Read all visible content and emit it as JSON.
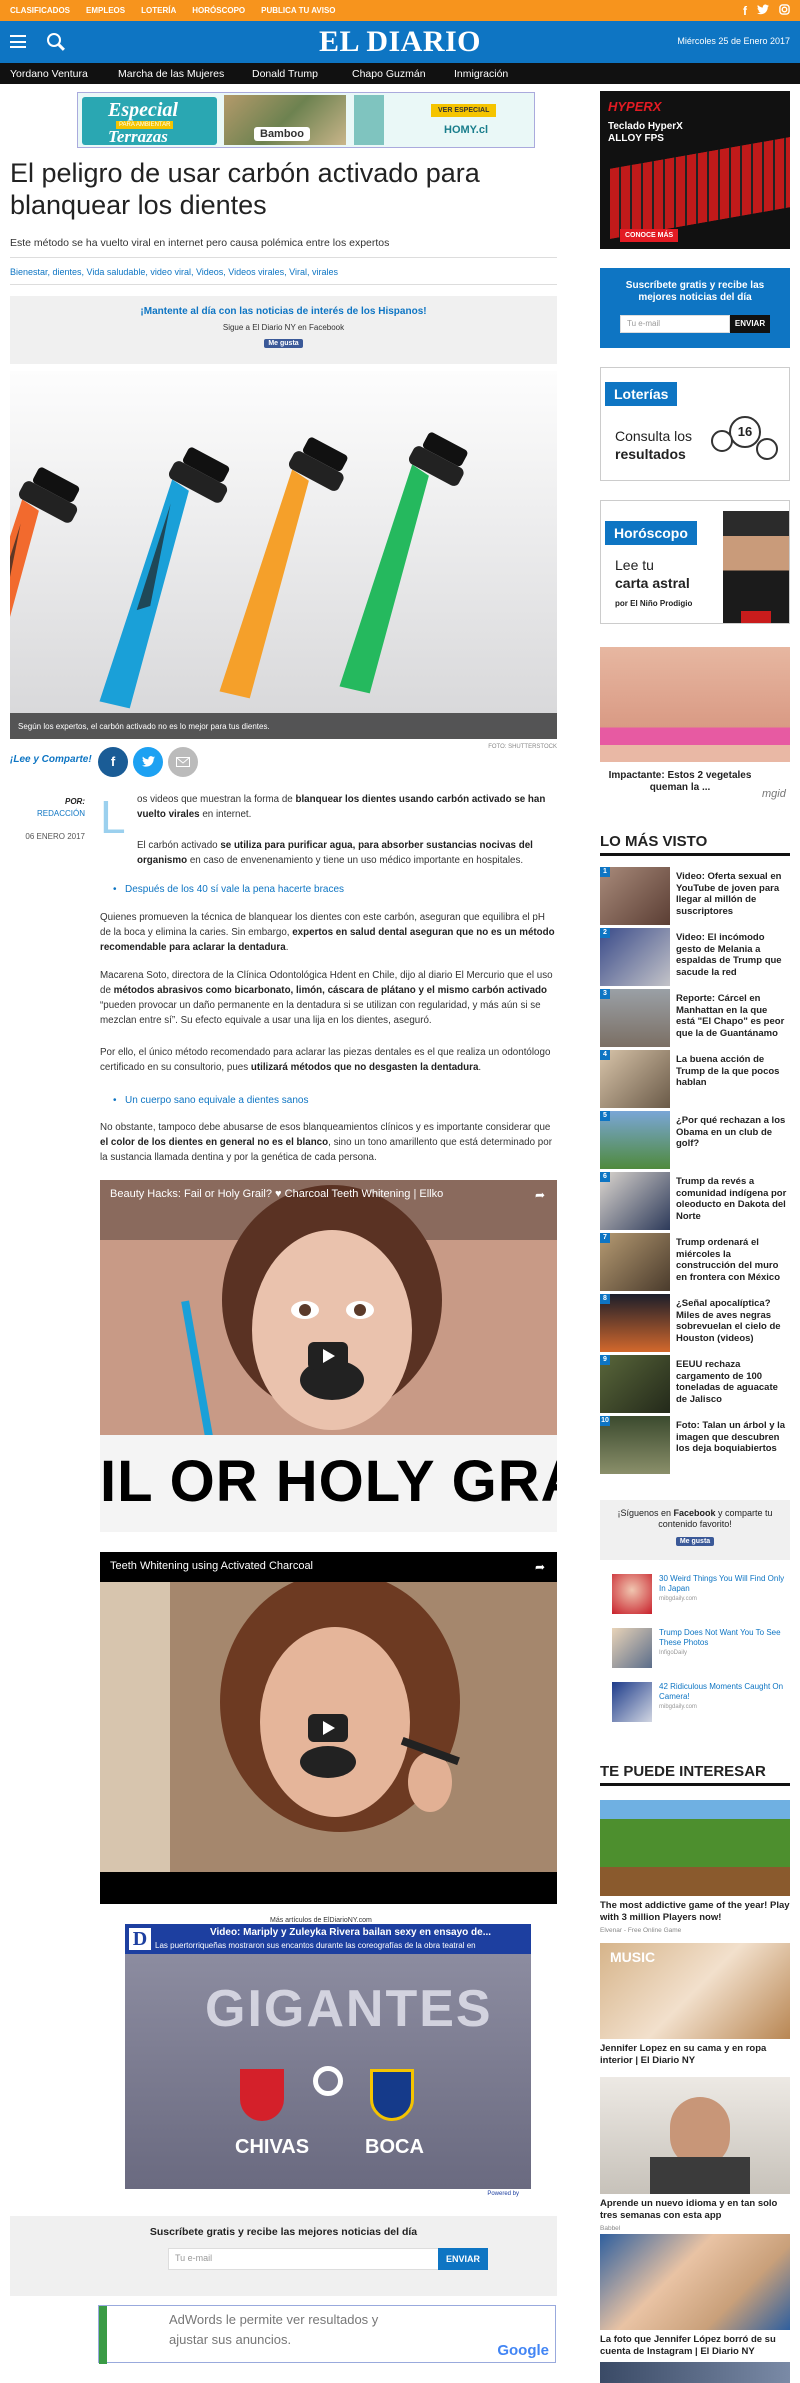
{
  "topbar": {
    "links": [
      "CLASIFICADOS",
      "EMPLEOS",
      "LOTERÍA",
      "HORÓSCOPO",
      "PUBLICA TU AVISO"
    ],
    "social": [
      "f",
      "t",
      "ig"
    ]
  },
  "header": {
    "logo": "EL DIARIO",
    "date": "Miércoles 25 de Enero 2017"
  },
  "nav": {
    "items": [
      "Yordano Ventura",
      "Marcha de las Mujeres",
      "Donald Trump",
      "Chapo Guzmán",
      "Inmigración"
    ]
  },
  "top_ad": {
    "headline": "Especial",
    "sub": "Terrazas",
    "badge": "PARA AMBIENTAR",
    "brand": "Bamboo",
    "cta": "VER ESPECIAL",
    "store": "HOMY.cl"
  },
  "side_ad": {
    "brand": "HYPERX",
    "line1": "Teclado HyperX",
    "line2": "ALLOY FPS",
    "cta": "CONOCE MÁS"
  },
  "article": {
    "title": "El peligro de usar carbón activado para blanquear los dientes",
    "subtitle": "Este método se ha vuelto viral en internet pero causa polémica entre los expertos",
    "tags": "Bienestar, dientes, Vida saludable, video viral, Videos, Videos virales, Viral, virales",
    "fb_promo": {
      "heading": "¡Mantente al día con las noticias de interés de los Hispanos!",
      "sub": "Sigue a El Diario NY en Facebook",
      "button": "Me gusta"
    },
    "hero_caption": "Según los expertos, el carbón activado no es lo mejor para tus dientes.",
    "photo_credit": "FOTO: SHUTTERSTOCK",
    "share_label": "¡Lee y Comparte!",
    "byline": {
      "por": "POR:",
      "author": "REDACCIÓN",
      "date": "06 ENERO 2017"
    },
    "dropcap": "L",
    "p1_a": "os videos que muestran la forma de ",
    "p1_b": "blanquear los dientes usando carbón activado se han vuelto virales",
    "p1_c": " en internet.",
    "p2_a": "El carbón activado ",
    "p2_b": "se utiliza para purificar agua, para absorber sustancias nocivas del organismo",
    "p2_c": " en caso de envenenamiento y tiene un uso médico importante en hospitales.",
    "link1": "Después de los 40 sí vale la pena hacerte braces",
    "p3_a": "Quienes promueven la técnica de blanquear los dientes con este carbón, aseguran que equilibra el pH de la boca y elimina la caries. Sin embargo, ",
    "p3_b": "expertos en salud dental aseguran que no es un método recomendable para aclarar la dentadura",
    "p3_c": ".",
    "p4_a": "Macarena Soto, directora de la Clínica Odontológica Hdent en Chile, dijo al diario El Mercurio que el uso de ",
    "p4_b": "métodos abrasivos como bicarbonato, limón, cáscara de plátano y el mismo carbón activado",
    "p4_c": " “pueden provocar un daño permanente en la dentadura si se utilizan con regularidad, y más aún si se mezclan entre sí”. Su efecto equivale a usar una lija en los dientes, aseguró.",
    "p5_a": "Por ello, el único método recomendado para aclarar las piezas dentales es el que realiza un odontólogo certificado en su consultorio, pues ",
    "p5_b": "utilizará métodos que no desgasten la dentadura",
    "p5_c": ".",
    "link2": "Un cuerpo sano equivale a dientes sanos",
    "p6_a": "No obstante, tampoco debe abusarse de esos blanqueamientos clínicos y es importante considerar que ",
    "p6_b": "el color de los dientes en general no es el blanco",
    "p6_c": ", sino un tono amarillento que está determinado por la sustancia llamada dentina y por la genética de cada persona.",
    "video1": {
      "title": "Beauty Hacks: Fail or Holy Grail? ♥ Charcoal Teeth Whitening | Ellko",
      "overlay": "IL OR HOLY GRAI"
    },
    "video2": {
      "title": "Teeth Whitening using Activated Charcoal"
    },
    "more_label": "Más artículos de ElDiarioNY.com",
    "more_video": {
      "title": "Video: Mariply y Zuleyka Rivera bailan sexy en ensayo de...",
      "desc": "Las puertorriqueñas mostraron sus encantos durante las coreografías de la obra teatral en",
      "big": "GIGANTES",
      "team1": "CHIVAS",
      "team2": "BOCA",
      "powered": "Powered by"
    },
    "subscribe": {
      "heading": "Suscríbete gratis y recibe las mejores noticias del día",
      "placeholder": "Tu e-mail",
      "button": "ENVIAR"
    },
    "google_ad": {
      "text1": "AdWords le permite ver resultados y",
      "text2": "ajustar sus anuncios.",
      "brand": "Google"
    }
  },
  "sidebar": {
    "subscribe": {
      "heading": "Suscríbete gratis y recibe las mejores noticias del día",
      "placeholder": "Tu e-mail",
      "button": "ENVIAR"
    },
    "loterias": {
      "label": "Loterías",
      "text1": "Consulta los",
      "text2": "resultados"
    },
    "horoscopo": {
      "label": "Horóscopo",
      "text1": "Lee tu",
      "text2": "carta astral",
      "text3": "por El Niño Prodigio"
    },
    "promo": {
      "text": "Impactante: Estos 2 vegetales queman la ...",
      "brand": "mgid"
    },
    "mas_visto": {
      "heading": "LO MÁS VISTO",
      "items": [
        {
          "num": "1",
          "title": "Video: Oferta sexual en YouTube de joven para llegar al millón de suscriptores"
        },
        {
          "num": "2",
          "title": "Video: El incómodo gesto de Melania a espaldas de Trump que sacude la red"
        },
        {
          "num": "3",
          "title": "Reporte: Cárcel en Manhattan en la que está \"El Chapo\" es peor que la de Guantánamo"
        },
        {
          "num": "4",
          "title": "La buena acción de Trump de la que pocos hablan"
        },
        {
          "num": "5",
          "title": "¿Por qué rechazan a los Obama en un club de golf?"
        },
        {
          "num": "6",
          "title": "Trump da revés a comunidad indígena por oleoducto en Dakota del Norte"
        },
        {
          "num": "7",
          "title": "Trump ordenará el miércoles la construcción del muro en frontera con México"
        },
        {
          "num": "8",
          "title": "¿Señal apocalíptica? Miles de aves negras sobrevuelan el cielo de Houston (videos)"
        },
        {
          "num": "9",
          "title": "EEUU rechaza cargamento de 100 toneladas de aguacate de Jalisco"
        },
        {
          "num": "10",
          "title": "Foto: Talan un árbol y la imagen que descubren los deja boquiabiertos"
        }
      ]
    },
    "fb_follow": {
      "text_a": "¡Síguenos en ",
      "text_b": "Facebook",
      "text_c": " y comparte tu contenido favorito!",
      "button": "Me gusta"
    },
    "recommended": [
      {
        "title": "30 Weird Things You Will Find Only In Japan",
        "source": "mibgdaily.com"
      },
      {
        "title": "Trump Does Not Want You To See These Photos",
        "source": "InfigoDaily"
      },
      {
        "title": "42 Ridiculous Moments Caught On Camera!",
        "source": "mibgdaily.com"
      }
    ],
    "te_puede": {
      "heading": "TE PUEDE INTERESAR",
      "items": [
        {
          "title": "The most addictive game of the year! Play with 3 million Players now!",
          "source": "Elvenar - Free Online Game"
        },
        {
          "title": "Jennifer Lopez en su cama y en ropa interior | El Diario NY",
          "source": ""
        },
        {
          "title": "Aprende un nuevo idioma y en tan solo tres semanas con esta app",
          "source": "Babbel"
        },
        {
          "title": "La foto que Jennifer López borró de su cuenta de Instagram | El Diario NY",
          "source": ""
        }
      ],
      "music_label": "MUSIC"
    }
  },
  "colors": {
    "orange": "#f7941d",
    "blue": "#0e75c3",
    "black": "#111111"
  }
}
